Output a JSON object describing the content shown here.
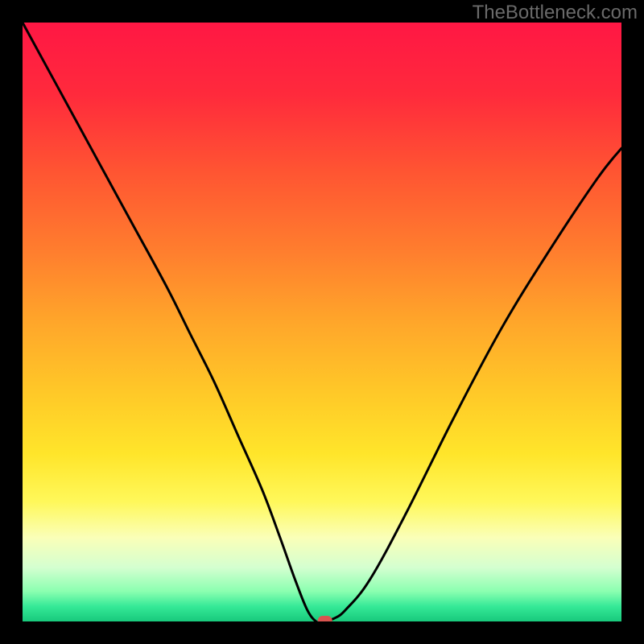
{
  "watermark": "TheBottleneck.com",
  "chart_data": {
    "type": "line",
    "title": "",
    "xlabel": "",
    "ylabel": "",
    "xlim": [
      0,
      100
    ],
    "ylim": [
      0,
      100
    ],
    "grid": false,
    "legend": false,
    "series": [
      {
        "name": "bottleneck-curve",
        "x": [
          0,
          6,
          12,
          18,
          24,
          28,
          32,
          36,
          40,
          43,
          45.5,
          47.5,
          49,
          50,
          52,
          54,
          58,
          64,
          72,
          80,
          88,
          96,
          100
        ],
        "y": [
          100,
          89,
          78,
          67,
          56,
          48,
          40,
          31,
          22,
          14,
          7,
          2,
          0,
          0,
          0.5,
          2,
          7,
          18,
          34,
          49,
          62,
          74,
          79
        ]
      }
    ],
    "marker": {
      "name": "optimal-point",
      "x": 50.5,
      "y": 0,
      "color": "#d9544f"
    },
    "gradient_stops": [
      {
        "offset": 0.0,
        "color": "#ff1744"
      },
      {
        "offset": 0.12,
        "color": "#ff2a3c"
      },
      {
        "offset": 0.25,
        "color": "#ff5532"
      },
      {
        "offset": 0.38,
        "color": "#ff7d2e"
      },
      {
        "offset": 0.5,
        "color": "#ffa62a"
      },
      {
        "offset": 0.62,
        "color": "#ffc928"
      },
      {
        "offset": 0.72,
        "color": "#ffe52a"
      },
      {
        "offset": 0.8,
        "color": "#fff85a"
      },
      {
        "offset": 0.86,
        "color": "#faffb8"
      },
      {
        "offset": 0.91,
        "color": "#d4ffd0"
      },
      {
        "offset": 0.95,
        "color": "#8affb0"
      },
      {
        "offset": 0.975,
        "color": "#35e997"
      },
      {
        "offset": 1.0,
        "color": "#18c97c"
      }
    ],
    "frame": {
      "color": "#000000",
      "width": 28
    }
  }
}
